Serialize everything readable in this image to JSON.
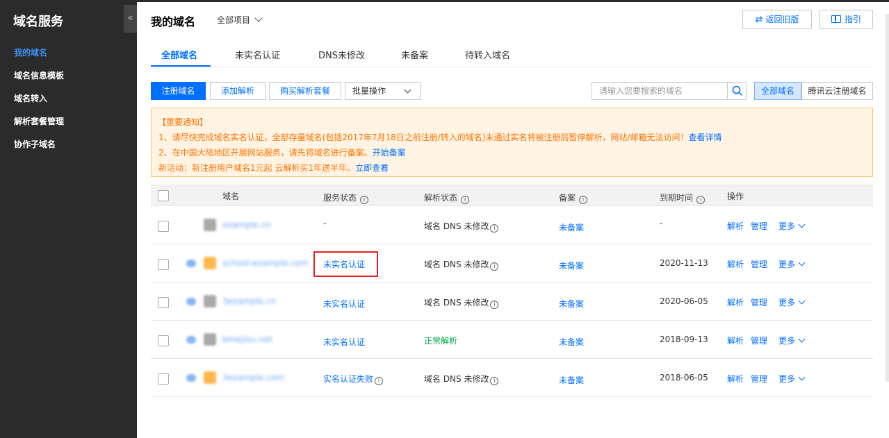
{
  "sidebar": {
    "title": "域名服务",
    "collapse_icon": "«",
    "items": [
      {
        "label": "我的域名",
        "active": true
      },
      {
        "label": "域名信息模板"
      },
      {
        "label": "域名转入"
      },
      {
        "label": "解析套餐管理"
      },
      {
        "label": "协作子域名"
      }
    ]
  },
  "header": {
    "title": "我的域名",
    "project": "全部项目",
    "back_old": "返回旧版",
    "guide": "指引"
  },
  "tabs": [
    "全部域名",
    "未实名认证",
    "DNS未修改",
    "未备案",
    "待转入域名"
  ],
  "toolbar": {
    "register": "注册域名",
    "add_resolve": "添加解析",
    "buy_package": "购买解析套餐",
    "batch": "批量操作",
    "search_placeholder": "请输入您要搜索的域名",
    "filter_all": "全部域名",
    "filter_tencent": "腾讯云注册域名"
  },
  "notice": {
    "title": "【重要通知】",
    "line1": "1、请尽快完成域名实名认证，全部存量域名(包括2017年7月18日之前注册/转入的域名)未通过实名将被注册局暂停解析，网站/邮箱无法访问！",
    "line1_link": "查看详情",
    "line2": "2、在中国大陆地区开展网站服务，请先将域名进行备案。",
    "line2_link": "开始备案",
    "line3": "新活动：新注册用户域名1元起 云解析买1年送半年。",
    "line3_link": "立即查看"
  },
  "table": {
    "headers": {
      "domain": "域名",
      "service": "服务状态",
      "resolve": "解析状态",
      "icp": "备案",
      "expiry": "到期时间",
      "ops": "操作"
    },
    "ops": {
      "resolve": "解析",
      "manage": "管理",
      "more": "更多"
    },
    "rows": [
      {
        "domain": "example.cn",
        "service": "-",
        "resolve": "域名 DNS 未修改",
        "icp": "未备案",
        "expiry": "-"
      },
      {
        "domain": "school-example.com",
        "service": "未实名认证",
        "resolve": "域名 DNS 未修改",
        "icp": "未备案",
        "expiry": "2020-11-13"
      },
      {
        "domain": "3example.cn",
        "service": "未实名认证",
        "resolve": "域名 DNS 未修改",
        "icp": "未备案",
        "expiry": "2020-06-05"
      },
      {
        "domain": "bmejiou.net",
        "service": "未实名认证",
        "resolve": "正常解析",
        "icp": "未备案",
        "expiry": "2018-09-13"
      },
      {
        "domain": "3example.com",
        "service": "实名认证失败",
        "resolve": "域名 DNS 未修改",
        "icp": "未备案",
        "expiry": "2018-06-05"
      }
    ]
  },
  "colors": {
    "accent": "#006eff",
    "sidebar": "#2b2b2b",
    "notice_bg": "#fff4e3",
    "highlight": "#e02020"
  }
}
